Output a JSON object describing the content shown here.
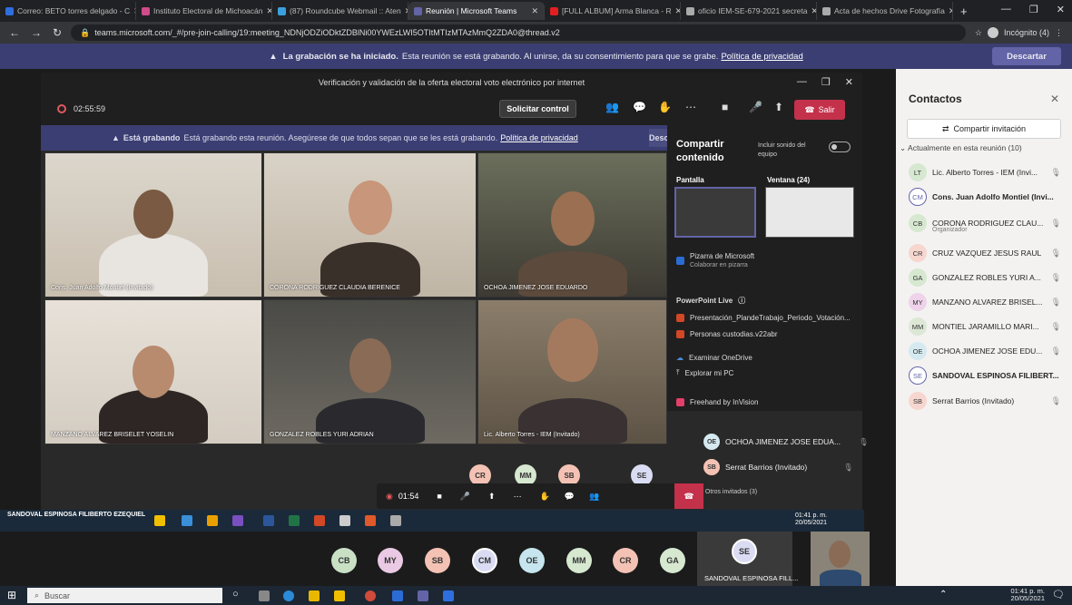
{
  "browser": {
    "tabs": [
      {
        "label": "Correo: BETO torres delgado - C",
        "color": "#2e6fe0"
      },
      {
        "label": "Instituto Electoral de Michoacán",
        "color": "#d04b8a"
      },
      {
        "label": "(87) Roundcube Webmail :: Aten",
        "color": "#3aa0e0"
      },
      {
        "label": "Reunión | Microsoft Teams",
        "color": "#6264a7",
        "active": true
      },
      {
        "label": "[FULL ALBUM] Arma Blanca - R",
        "color": "#e02020"
      },
      {
        "label": "oficio IEM-SE-679-2021 secreta",
        "color": "#aaa"
      },
      {
        "label": "Acta de hechos Drive Fotografía",
        "color": "#aaa"
      }
    ],
    "url": "teams.microsoft.com/_#/pre-join-calling/19:meeting_NDNjODZiODktZDBlNi00YWEzLWI5OTItMTIzMTAzMmQ2ZDA0@thread.v2",
    "incognito_label": "Incógnito (4)"
  },
  "banner": {
    "bold": "La grabación se ha iniciado.",
    "text": "Esta reunión se está grabando. Al unirse, da su consentimiento para que se grabe.",
    "link": "Política de privacidad",
    "discard": "Descartar"
  },
  "meeting": {
    "title": "Verificación y validación de la oferta electoral voto electrónico por internet",
    "timer": "02:55:59",
    "request_control": "Solicitar control",
    "leave": "Salir",
    "inner_banner_bold": "Está grabando",
    "inner_banner_text": "Está grabando esta reunión. Asegúrese de que todos sepan que se les está grabando.",
    "inner_banner_link": "Política de privacidad",
    "inner_banner_dismiss": "Desc",
    "tiles": [
      "Cons. Juan Adolfo Montiel (Invitado)",
      "CORONA RODRIGUEZ CLAUDIA BERENICE",
      "OCHOA JIMENEZ JOSE EDUARDO",
      "MANZANO ALVAREZ BRISELET YOSELIN",
      "GONZALEZ ROBLES YURI ADRIAN",
      "Lic. Alberto Torres - IEM (Invitado)"
    ],
    "share_panel": {
      "title": "Compartir contenido",
      "include_sound": "Incluir sonido del equipo",
      "screen": "Pantalla",
      "window": "Ventana (24)",
      "whiteboard": "Pizarra de Microsoft",
      "whiteboard_sub": "Colaborar en pizarra",
      "ppt_live": "PowerPoint Live",
      "files": [
        "Presentación_PlandeTrabajo_Periodo_Votación...",
        "Personas custodias.v22abr"
      ],
      "onedrive": "Examinar OneDrive",
      "pc": "Explorar mi PC",
      "freehand": "Freehand by InVision"
    },
    "side_participants": [
      {
        "initials": "OE",
        "name": "OCHOA JIMENEZ JOSE EDUA..."
      },
      {
        "initials": "SB",
        "name": "Serrat Barrios (Invitado)"
      }
    ],
    "others": "Otros invitados (3)",
    "bottom_avatars": [
      "CR",
      "MM",
      "SB",
      "SE"
    ],
    "call_time": "01:54"
  },
  "inner_taskbar": {
    "presenter": "SANDOVAL ESPINOSA FILIBERTO EZEQUIEL",
    "time": "01:41 p. m.",
    "date": "20/05/2021"
  },
  "strip": {
    "avatars": [
      {
        "i": "CB",
        "c": "#c9e0c5"
      },
      {
        "i": "MY",
        "c": "#e9c9e3"
      },
      {
        "i": "SB",
        "c": "#f4c2b4"
      },
      {
        "i": "CM",
        "c": "#d9dcf2"
      },
      {
        "i": "OE",
        "c": "#c6e5ee"
      },
      {
        "i": "MM",
        "c": "#d6e8d0"
      },
      {
        "i": "CR",
        "c": "#f4c2b4"
      },
      {
        "i": "GA",
        "c": "#d6e8d0"
      }
    ],
    "big_initials": "SE",
    "big_label": "SANDOVAL ESPINOSA FILL..."
  },
  "contacts": {
    "title": "Contactos",
    "invite": "Compartir invitación",
    "in_meeting": "Actualmente en esta reunión (10)",
    "people": [
      {
        "i": "LT",
        "name": "Lic. Alberto Torres - IEM (Invi...",
        "c": "#d6e8d0"
      },
      {
        "i": "CM",
        "name": "Cons. Juan Adolfo Montiel (Invi...",
        "c": "#fff",
        "bold": true,
        "sel": true
      },
      {
        "i": "CB",
        "name": "CORONA RODRIGUEZ CLAU...",
        "c": "#d6e8d0",
        "org": "Organizador"
      },
      {
        "i": "CR",
        "name": "CRUZ VAZQUEZ JESUS RAUL",
        "c": "#f6d6cf"
      },
      {
        "i": "GA",
        "name": "GONZALEZ ROBLES YURI A...",
        "c": "#d6e8d0"
      },
      {
        "i": "MY",
        "name": "MANZANO ALVAREZ BRISEL...",
        "c": "#eed3ea"
      },
      {
        "i": "MM",
        "name": "MONTIEL JARAMILLO MARI...",
        "c": "#dde7d6"
      },
      {
        "i": "OE",
        "name": "OCHOA JIMENEZ JOSE EDU...",
        "c": "#d5e9f0"
      },
      {
        "i": "SE",
        "name": "SANDOVAL ESPINOSA FILIBERT...",
        "c": "#fff",
        "bold": true,
        "sel": true
      },
      {
        "i": "SB",
        "name": "Serrat Barrios (Invitado)",
        "c": "#f6d6cf"
      }
    ]
  },
  "taskbar": {
    "search": "Buscar",
    "time": "01:41 p. m.",
    "date": "20/05/2021"
  }
}
